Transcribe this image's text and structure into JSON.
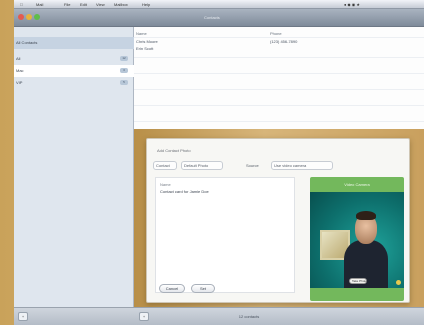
{
  "menubar": {
    "items": [
      "Mail",
      "File",
      "Edit",
      "View",
      "Mailbox",
      "Help"
    ]
  },
  "window": {
    "title": "Contacts"
  },
  "sidebar": {
    "items": [
      {
        "label": "All Contacts",
        "count": ""
      },
      {
        "label": "All",
        "count": "12"
      },
      {
        "label": "Mac",
        "count": "3"
      },
      {
        "label": "VIP",
        "count": "5"
      }
    ]
  },
  "list": {
    "headers": [
      "Name",
      "Phone"
    ],
    "rows": [
      {
        "name": "Chris Moore",
        "phone": "(123) 456-7890"
      },
      {
        "name": "Erin Scott",
        "phone": ""
      }
    ]
  },
  "dialog": {
    "title": "Add Contact Photo",
    "tabs": [
      "Contact",
      "Default Photo",
      "Source",
      "Use video camera"
    ],
    "field_caption": "Name",
    "field_value": "Contact card for Jamie Doe",
    "cancel_label": "Cancel",
    "set_label": "Set",
    "video_header": "Video Camera",
    "snapshot_label": "Take Photo"
  },
  "status": {
    "text": "12 contacts"
  },
  "colors": {
    "dialog_bg": "#f7f7f4",
    "video_panel": "#73b85c",
    "stage_wood": "#c9a05e"
  }
}
